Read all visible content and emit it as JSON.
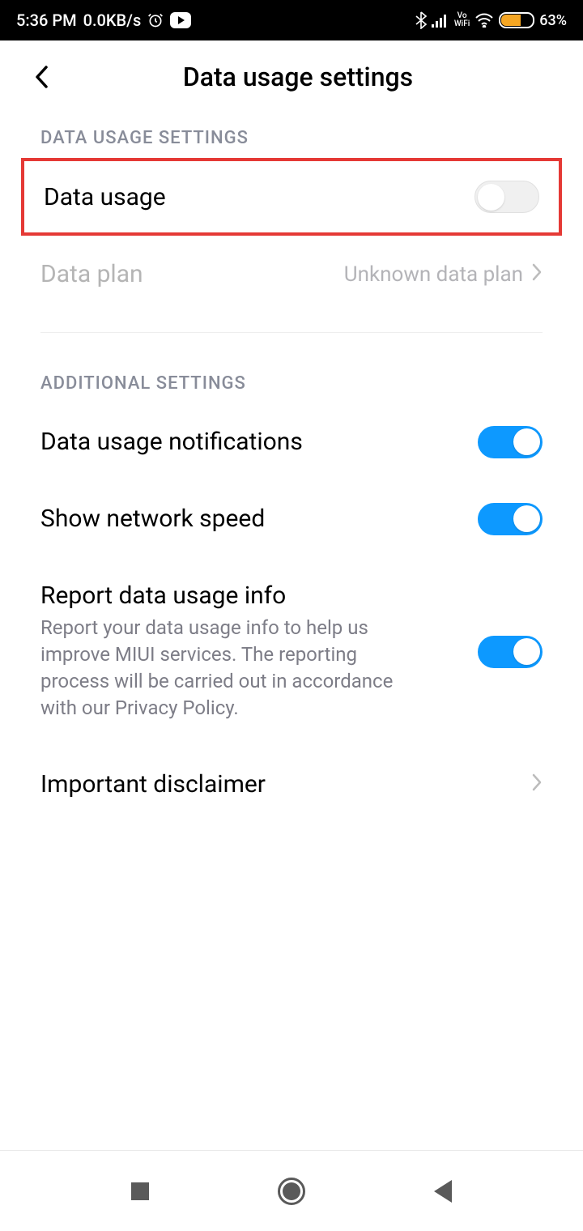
{
  "status": {
    "time": "5:36 PM",
    "net_speed": "0.0KB/s",
    "battery": "63%"
  },
  "header": {
    "title": "Data usage settings"
  },
  "sections": {
    "data_usage_header": "DATA USAGE SETTINGS",
    "additional_header": "ADDITIONAL SETTINGS"
  },
  "rows": {
    "data_usage": {
      "title": "Data usage"
    },
    "data_plan": {
      "title": "Data plan",
      "value": "Unknown data plan"
    },
    "notifications": {
      "title": "Data usage notifications"
    },
    "network_speed": {
      "title": "Show network speed"
    },
    "report": {
      "title": "Report data usage info",
      "subtitle": "Report your data usage info to help us improve MIUI services. The reporting process will be carried out in accordance with our Privacy Policy."
    },
    "disclaimer": {
      "title": "Important disclaimer"
    }
  }
}
